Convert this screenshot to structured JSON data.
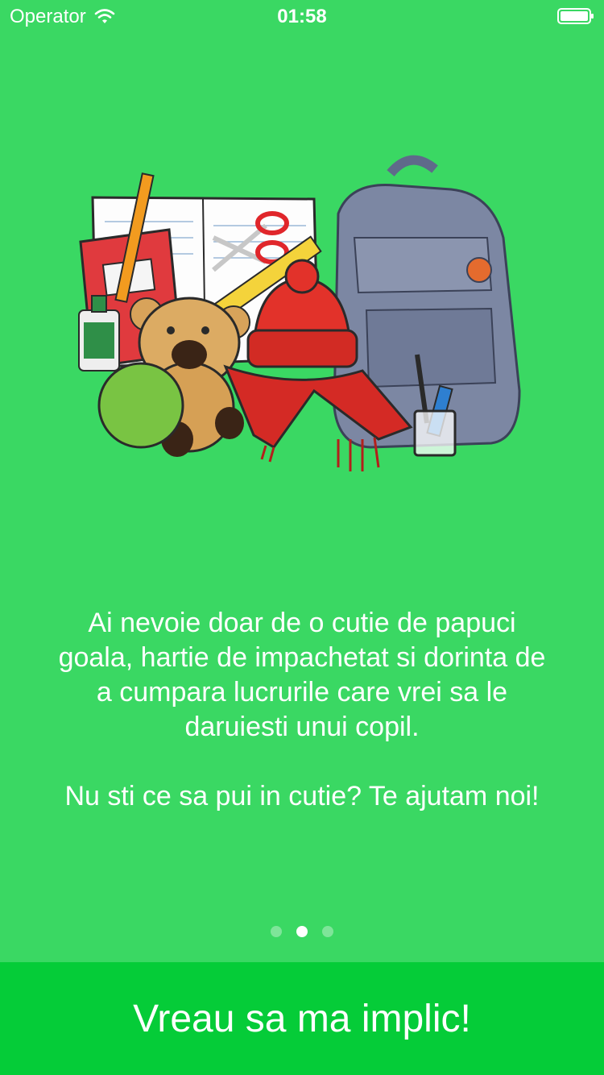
{
  "status_bar": {
    "carrier": "Operator",
    "time": "01:58"
  },
  "illustration": {
    "icon": "donation-items-illustration"
  },
  "message": {
    "paragraph_1": "Ai nevoie doar de o cutie de papuci goala, hartie de impachetat si dorinta de a cumpara lucrurile care vrei sa le daruiesti unui copil.",
    "paragraph_2": "Nu sti ce sa pui in cutie? Te ajutam noi!"
  },
  "pager": {
    "total_pages": 3,
    "current_page": 2
  },
  "cta": {
    "label": "Vreau sa ma implic!"
  },
  "colors": {
    "background": "#3ad863",
    "cta_background": "#05cc38",
    "text": "#ffffff"
  }
}
